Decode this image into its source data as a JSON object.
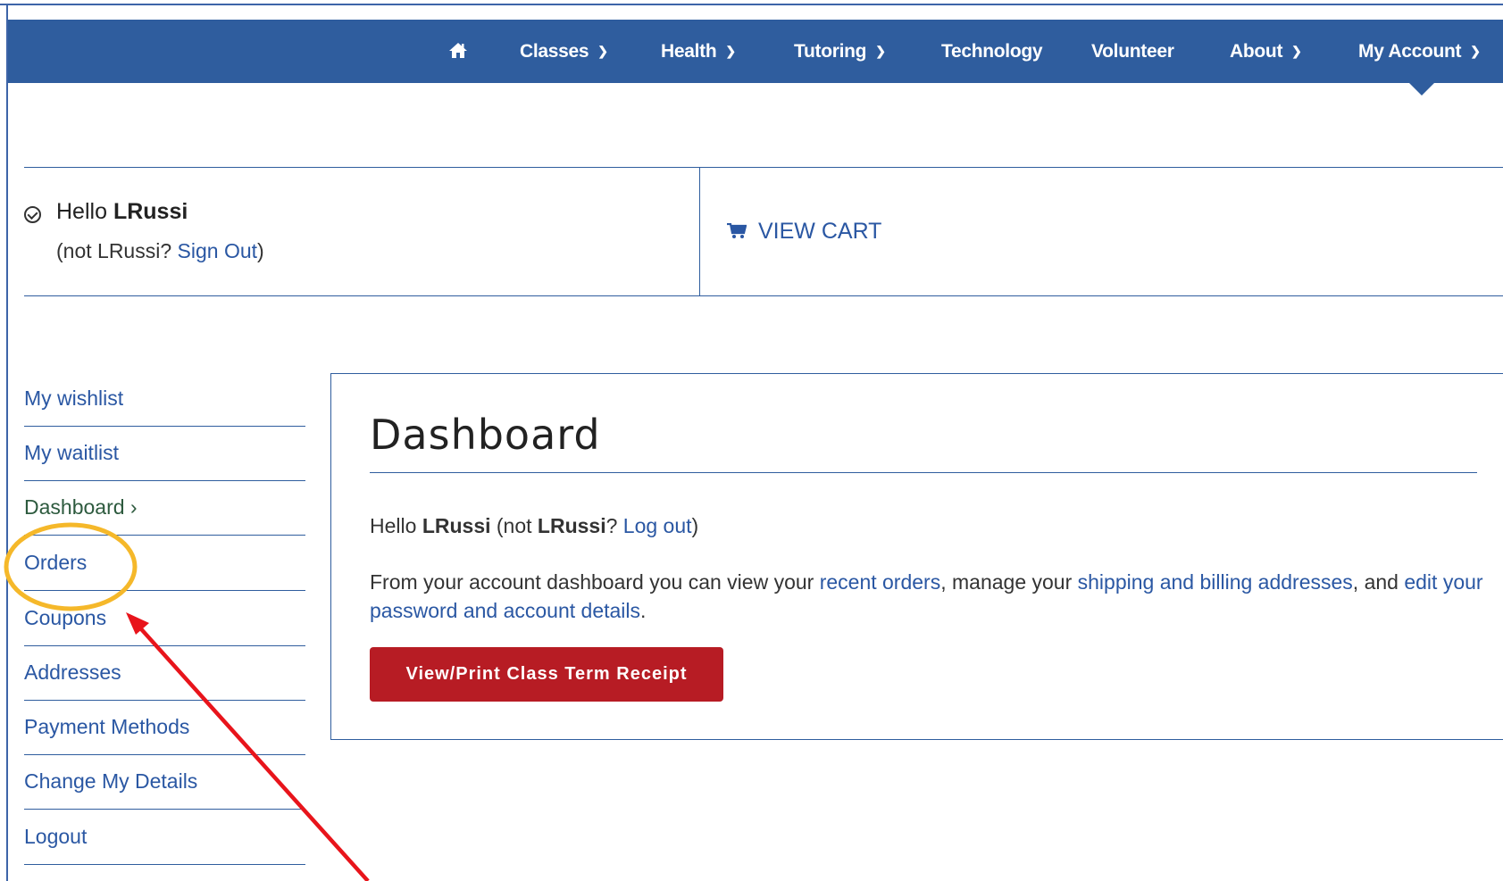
{
  "nav": {
    "home_icon": "home-icon",
    "items": [
      {
        "label": "Classes",
        "dropdown": true
      },
      {
        "label": "Health",
        "dropdown": true
      },
      {
        "label": "Tutoring",
        "dropdown": true
      },
      {
        "label": "Technology",
        "dropdown": false
      },
      {
        "label": "Volunteer",
        "dropdown": false
      },
      {
        "label": "About",
        "dropdown": true
      },
      {
        "label": "My Account",
        "dropdown": true
      }
    ]
  },
  "welcome": {
    "hello": "Hello",
    "username": "LRussi",
    "not_prefix": "(not LRussi?",
    "sign_out": "Sign Out",
    "not_suffix": ")",
    "cart_label": "VIEW CART"
  },
  "sidebar": {
    "items": [
      {
        "label": "My wishlist"
      },
      {
        "label": "My waitlist"
      },
      {
        "label": "Dashboard ›"
      },
      {
        "label": "Orders"
      },
      {
        "label": "Coupons"
      },
      {
        "label": "Addresses"
      },
      {
        "label": "Payment Methods"
      },
      {
        "label": "Change My Details"
      },
      {
        "label": "Logout"
      }
    ]
  },
  "dashboard": {
    "title": "Dashboard",
    "hello": "Hello",
    "username": "LRussi",
    "not_prefix": "(not",
    "not_user": "LRussi",
    "q": "?",
    "logout": "Log out",
    "close": ")",
    "intro": "From your account dashboard you can view your",
    "recent_orders": "recent orders",
    "manage": ", manage your",
    "addresses": "shipping and billing addresses",
    "and": ", and",
    "edit": "edit your password and account details",
    "period": ".",
    "receipt_button": "View/Print Class Term Receipt"
  },
  "colors": {
    "nav_bg": "#2f5d9e",
    "link": "#2a57a3",
    "button": "#b71c24",
    "highlight_circle": "#f5b82a",
    "arrow": "#e8141b"
  }
}
